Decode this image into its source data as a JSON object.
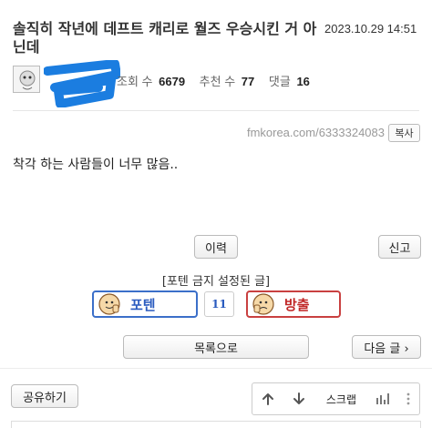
{
  "post": {
    "title": "솔직히 작년에 데프트 캐리로 월즈 우승시킨 거 아닌데",
    "datetime": "2023.10.29 14:51",
    "content": "착각 하는 사람들이 너무 많음.."
  },
  "stats": {
    "views_label": "조회 수",
    "views": "6679",
    "recommend_label": "추천 수",
    "recommend": "77",
    "comments_label": "댓글",
    "comments": "16"
  },
  "url": {
    "text": "fmkorea.com/6333324083",
    "copy_label": "복사"
  },
  "actions": {
    "history": "이력",
    "report": "신고",
    "potten_notice": "[포텐 금지 설정된 글]",
    "vote_up": "포텐",
    "vote_count": "11",
    "vote_down": "방출",
    "list": "목록으로",
    "next": "다음 글 ›",
    "share": "공유하기",
    "scrap": "스크랩"
  },
  "colors": {
    "scribble": "#1b7de0",
    "vote_up": "#3b6fc9",
    "vote_down": "#c94040"
  }
}
